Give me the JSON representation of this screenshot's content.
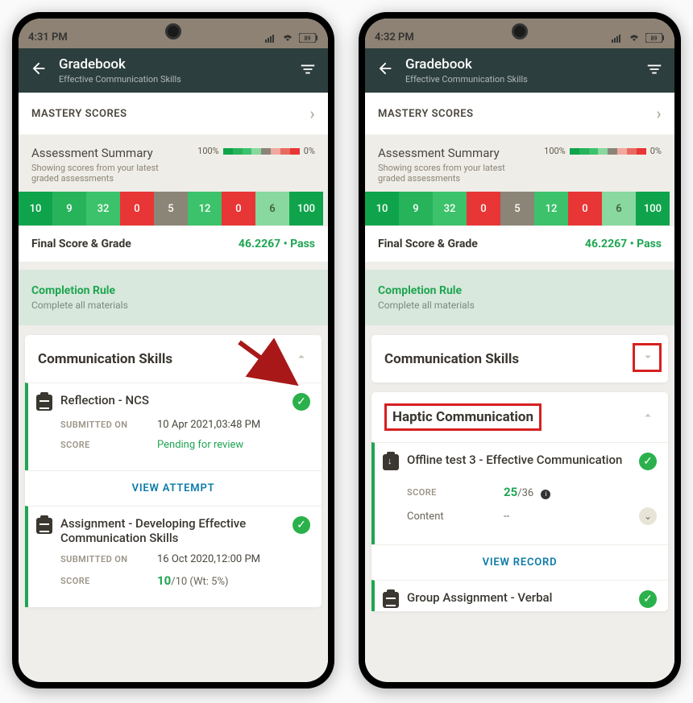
{
  "left": {
    "status_time": "4:31 PM",
    "battery": "89",
    "header_title": "Gradebook",
    "header_subtitle": "Effective Communication Skills",
    "mastery_label": "MASTERY SCORES",
    "summary_title": "Assessment Summary",
    "summary_desc": "Showing scores from your latest graded assessments",
    "legend_100": "100%",
    "legend_0": "0%",
    "scores": [
      {
        "v": "10",
        "c": "#0fa44b"
      },
      {
        "v": "9",
        "c": "#27b35a"
      },
      {
        "v": "32",
        "c": "#3cc26a"
      },
      {
        "v": "0",
        "c": "#e83535"
      },
      {
        "v": "5",
        "c": "#8b8577"
      },
      {
        "v": "12",
        "c": "#3cc26a"
      },
      {
        "v": "0",
        "c": "#e83535"
      },
      {
        "v": "6",
        "c": "#88d89f"
      },
      {
        "v": "100",
        "c": "#0fa44b"
      }
    ],
    "final_label": "Final Score & Grade",
    "final_value": "46.2267 • Pass",
    "comp_title": "Completion Rule",
    "comp_desc": "Complete all materials",
    "section_title": "Communication Skills",
    "item1_title": "Reflection - NCS",
    "submitted_label": "SUBMITTED ON",
    "item1_submitted": "10 Apr 2021,03:48 PM",
    "score_label": "SCORE",
    "item1_score": "Pending for review",
    "view_attempt": "VIEW ATTEMPT",
    "item2_title": "Assignment - Developing Effective Communication Skills",
    "item2_submitted": "16 Oct 2020,12:00 PM",
    "item2_score_val": "10",
    "item2_score_total": "/10 (Wt: 5%)"
  },
  "right": {
    "status_time": "4:32 PM",
    "battery": "89",
    "header_title": "Gradebook",
    "header_subtitle": "Effective Communication Skills",
    "mastery_label": "MASTERY SCORES",
    "summary_title": "Assessment Summary",
    "summary_desc": "Showing scores from your latest graded assessments",
    "legend_100": "100%",
    "legend_0": "0%",
    "scores": [
      {
        "v": "10",
        "c": "#0fa44b"
      },
      {
        "v": "9",
        "c": "#27b35a"
      },
      {
        "v": "32",
        "c": "#3cc26a"
      },
      {
        "v": "0",
        "c": "#e83535"
      },
      {
        "v": "5",
        "c": "#8b8577"
      },
      {
        "v": "12",
        "c": "#3cc26a"
      },
      {
        "v": "0",
        "c": "#e83535"
      },
      {
        "v": "6",
        "c": "#88d89f"
      },
      {
        "v": "100",
        "c": "#0fa44b"
      }
    ],
    "final_label": "Final Score & Grade",
    "final_value": "46.2267 • Pass",
    "comp_title": "Completion Rule",
    "comp_desc": "Complete all materials",
    "section1_title": "Communication Skills",
    "section2_title": "Haptic Communication",
    "score_label": "SCORE",
    "item1_title": "Offline test 3 - Effective Communication",
    "item1_score_val": "25",
    "item1_score_total": "/36",
    "content_label": "Content",
    "content_value": "--",
    "view_record": "VIEW RECORD",
    "item2_title": "Group Assignment - Verbal"
  }
}
